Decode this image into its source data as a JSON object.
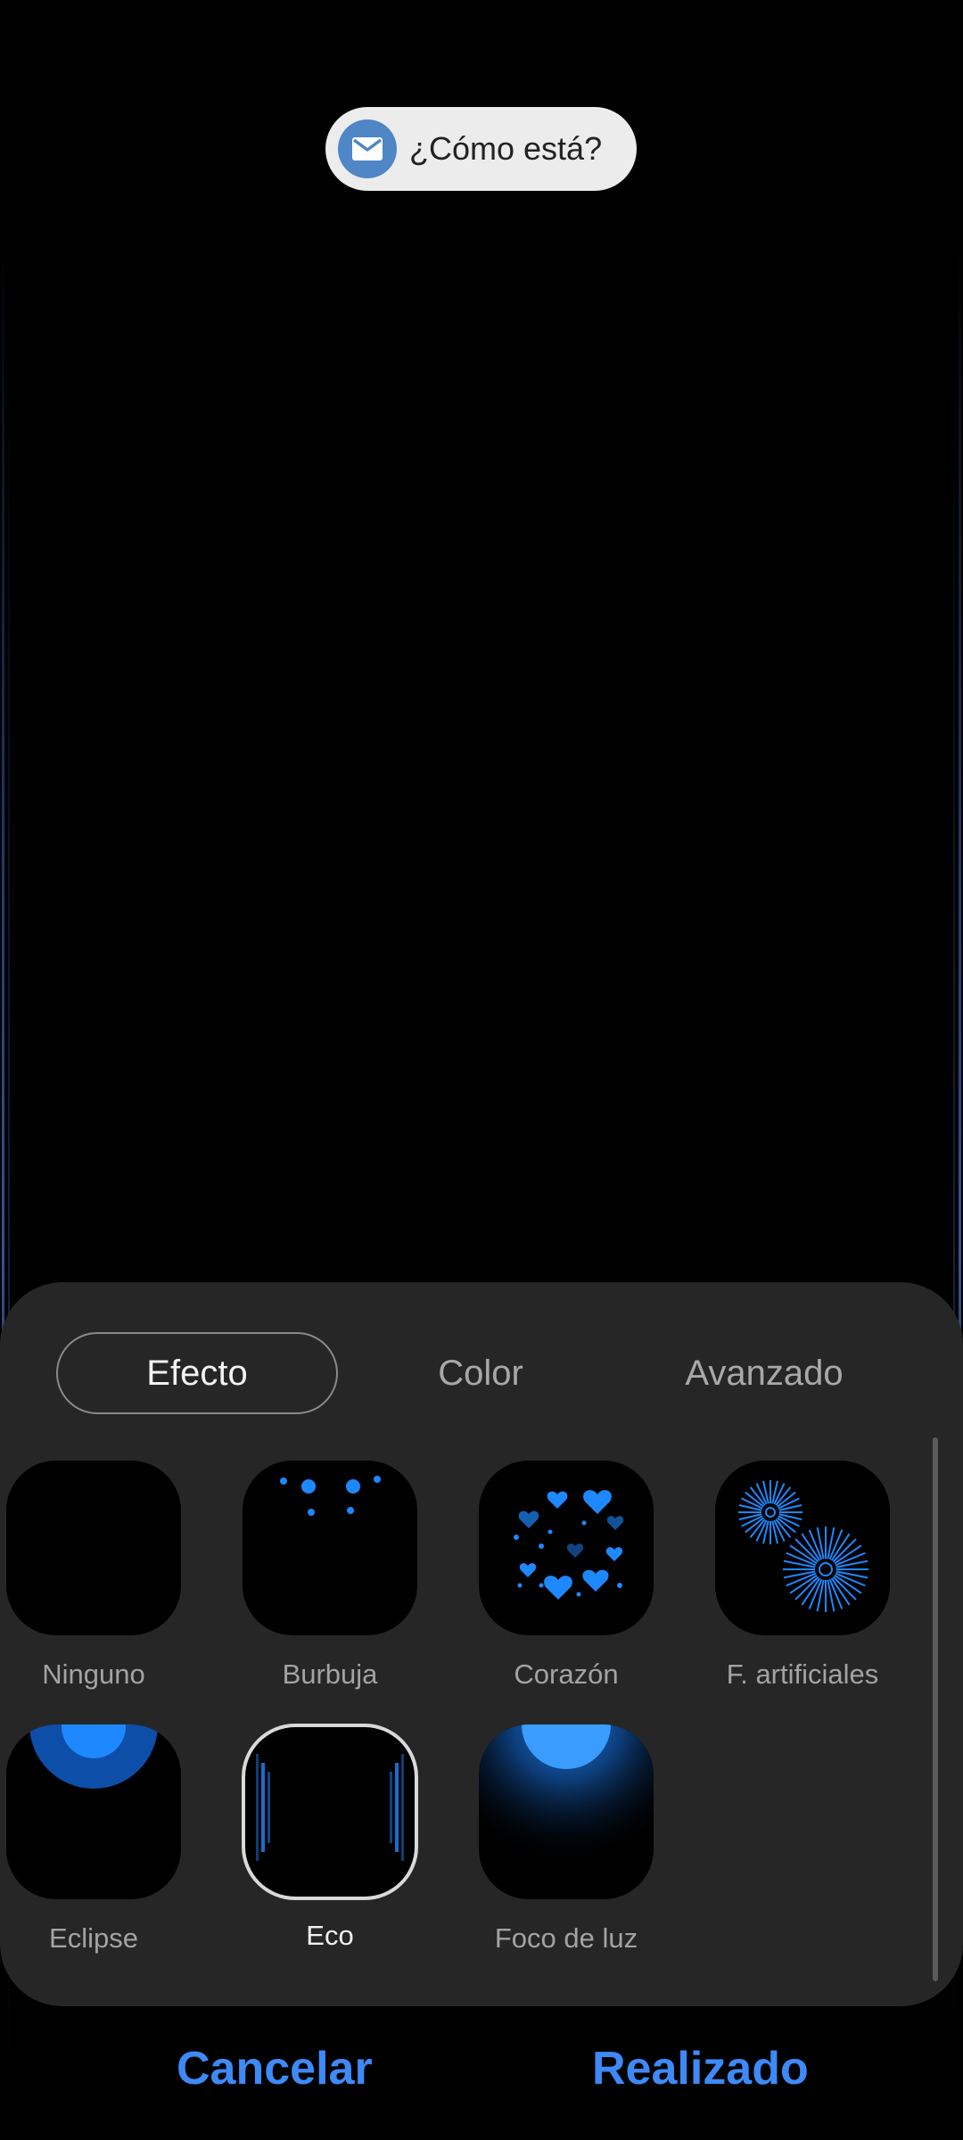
{
  "notification": {
    "message": "¿Cómo está?",
    "icon": "mail-icon"
  },
  "tabs": [
    {
      "label": "Efecto",
      "selected": true
    },
    {
      "label": "Color",
      "selected": false
    },
    {
      "label": "Avanzado",
      "selected": false
    }
  ],
  "effects": [
    {
      "label": "Ninguno",
      "icon": "none-preview",
      "selected": false
    },
    {
      "label": "Burbuja",
      "icon": "bubble-preview",
      "selected": false
    },
    {
      "label": "Corazón",
      "icon": "heart-preview",
      "selected": false
    },
    {
      "label": "F. artificiales",
      "icon": "fireworks-preview",
      "selected": false
    },
    {
      "label": "Eclipse",
      "icon": "eclipse-preview",
      "selected": false
    },
    {
      "label": "Eco",
      "icon": "echo-preview",
      "selected": true
    },
    {
      "label": "Foco de luz",
      "icon": "spotlight-preview",
      "selected": false
    }
  ],
  "actions": {
    "cancel": "Cancelar",
    "done": "Realizado"
  },
  "colors": {
    "accent": "#3d8af7",
    "effect_blue": "#1e88ff",
    "sheet_background": "#262626"
  }
}
